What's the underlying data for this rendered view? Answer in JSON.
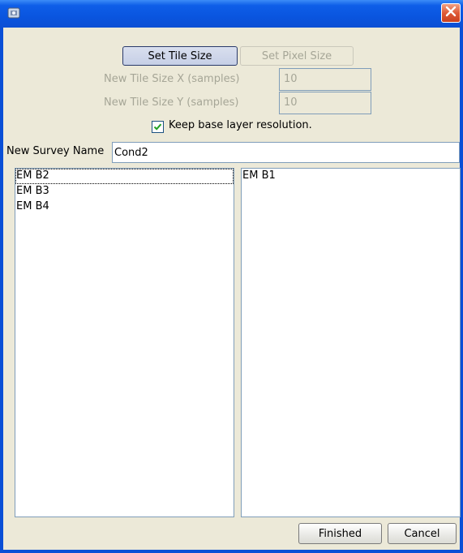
{
  "titlebar": {
    "title": "",
    "icon": "app-icon",
    "close_icon": "close-icon"
  },
  "mode_buttons": {
    "set_tile_size": "Set Tile Size",
    "set_pixel_size": "Set Pixel Size"
  },
  "tile_size": {
    "x_label": "New Tile Size X (samples)",
    "x_value": "10",
    "y_label": "New Tile Size Y (samples)",
    "y_value": "10"
  },
  "keep_resolution": {
    "label": "Keep base layer resolution.",
    "checked": true
  },
  "survey_name": {
    "label": "New Survey Name",
    "value": "Cond2"
  },
  "left_list": {
    "items": [
      "EM B2",
      "EM B3",
      "EM B4"
    ],
    "focused_index": 0
  },
  "right_list": {
    "items": [
      "EM B1"
    ]
  },
  "footer": {
    "finished": "Finished",
    "cancel": "Cancel"
  },
  "colors": {
    "titlebar": "#0a55df",
    "dialog_bg": "#ece9d8",
    "close": "#de5a37"
  }
}
